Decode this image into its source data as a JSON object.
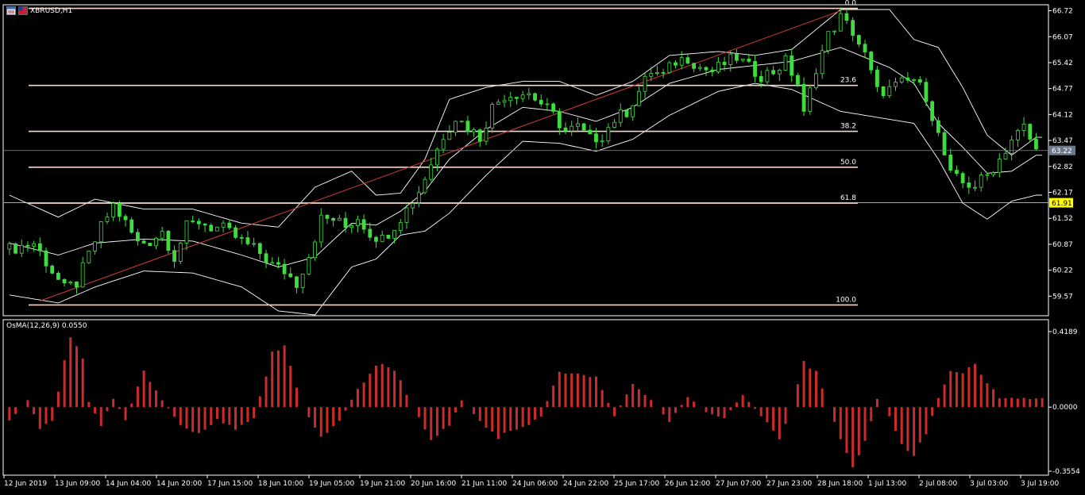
{
  "window": {
    "symbol_title": "XBRUSD,H1"
  },
  "indicator": {
    "label": "OsMA(12,26,9) 0.0550"
  },
  "colors": {
    "bg": "#000000",
    "frame": "#ffffff",
    "candle": "#3fdc3f",
    "fib": "#f7d6c8",
    "trend": "#d23b3b",
    "bands": "#ffffff",
    "osma": "#cc2b2b",
    "price_tag_bg": "#6b7b8c",
    "fib_tag_bg": "#ffff00"
  },
  "icons": {
    "window_icon": "chart-window-icon",
    "flag_icon": "symbol-flag-icon"
  },
  "chart_data": [
    {
      "type": "candlestick",
      "title": "XBRUSD,H1",
      "y_ticks": [
        "66.72",
        "66.07",
        "65.42",
        "64.77",
        "64.12",
        "63.47",
        "62.82",
        "62.17",
        "61.52",
        "60.87",
        "60.22",
        "59.57"
      ],
      "ylim": [
        59.1,
        66.85
      ],
      "x_ticks": [
        "12 Jun 2019",
        "13 Jun 09:00",
        "14 Jun 04:00",
        "14 Jun 20:00",
        "17 Jun 15:00",
        "18 Jun 10:00",
        "19 Jun 05:00",
        "19 Jun 21:00",
        "20 Jun 16:00",
        "21 Jun 11:00",
        "24 Jun 06:00",
        "24 Jun 22:00",
        "25 Jun 17:00",
        "26 Jun 12:00",
        "27 Jun 07:00",
        "27 Jun 23:00",
        "28 Jun 18:00",
        "1 Jul 13:00",
        "2 Jul 08:00",
        "3 Jul 03:00",
        "3 Jul 19:00"
      ],
      "close_path": [
        [
          0,
          60.75
        ],
        [
          4,
          60.9
        ],
        [
          7,
          60.2
        ],
        [
          9,
          59.75
        ],
        [
          11,
          59.9
        ],
        [
          13,
          60.6
        ],
        [
          15,
          61.3
        ],
        [
          17,
          61.85
        ],
        [
          19,
          61.4
        ],
        [
          21,
          60.9
        ],
        [
          23,
          60.95
        ],
        [
          25,
          61.2
        ],
        [
          27,
          60.55
        ],
        [
          29,
          61.3
        ],
        [
          31,
          61.45
        ],
        [
          33,
          61.3
        ],
        [
          35,
          61.25
        ],
        [
          37,
          61.05
        ],
        [
          39,
          60.85
        ],
        [
          41,
          60.65
        ],
        [
          43,
          60.35
        ],
        [
          45,
          60.2
        ],
        [
          47,
          59.9
        ],
        [
          49,
          60.6
        ],
        [
          51,
          61.5
        ],
        [
          53,
          61.5
        ],
        [
          55,
          61.3
        ],
        [
          57,
          61.55
        ],
        [
          59,
          61.15
        ],
        [
          61,
          61.0
        ],
        [
          63,
          61.35
        ],
        [
          65,
          61.75
        ],
        [
          67,
          62.2
        ],
        [
          69,
          62.9
        ],
        [
          71,
          63.6
        ],
        [
          73,
          64.05
        ],
        [
          75,
          63.8
        ],
        [
          77,
          63.55
        ],
        [
          79,
          64.3
        ],
        [
          81,
          64.6
        ],
        [
          83,
          64.65
        ],
        [
          85,
          64.65
        ],
        [
          87,
          64.4
        ],
        [
          89,
          64.1
        ],
        [
          91,
          63.7
        ],
        [
          93,
          63.8
        ],
        [
          95,
          63.5
        ],
        [
          97,
          63.6
        ],
        [
          99,
          64.0
        ],
        [
          101,
          64.2
        ],
        [
          103,
          64.7
        ],
        [
          105,
          65.2
        ],
        [
          107,
          65.1
        ],
        [
          109,
          65.45
        ],
        [
          111,
          65.55
        ],
        [
          113,
          65.3
        ],
        [
          115,
          65.2
        ],
        [
          117,
          65.4
        ],
        [
          119,
          65.55
        ],
        [
          121,
          65.3
        ],
        [
          123,
          65.1
        ],
        [
          125,
          65.2
        ],
        [
          127,
          65.45
        ],
        [
          129,
          64.9
        ],
        [
          130,
          64.1
        ],
        [
          132,
          65.3
        ],
        [
          134,
          66.1
        ],
        [
          136,
          66.55
        ],
        [
          138,
          66.2
        ],
        [
          140,
          65.6
        ],
        [
          142,
          64.7
        ],
        [
          144,
          64.75
        ],
        [
          146,
          64.9
        ],
        [
          148,
          65.0
        ],
        [
          150,
          64.6
        ],
        [
          152,
          63.6
        ],
        [
          154,
          62.6
        ],
        [
          156,
          62.4
        ],
        [
          158,
          62.35
        ],
        [
          160,
          62.6
        ],
        [
          162,
          63.0
        ],
        [
          164,
          63.5
        ],
        [
          166,
          63.8
        ],
        [
          168,
          63.2
        ]
      ],
      "bands_upper": [
        [
          0,
          62.1
        ],
        [
          8,
          61.55
        ],
        [
          14,
          62.0
        ],
        [
          22,
          61.75
        ],
        [
          30,
          61.75
        ],
        [
          38,
          61.4
        ],
        [
          44,
          61.3
        ],
        [
          50,
          62.3
        ],
        [
          56,
          62.7
        ],
        [
          60,
          62.1
        ],
        [
          64,
          62.15
        ],
        [
          68,
          63.0
        ],
        [
          72,
          64.5
        ],
        [
          78,
          64.8
        ],
        [
          84,
          64.95
        ],
        [
          90,
          64.95
        ],
        [
          96,
          64.6
        ],
        [
          102,
          64.95
        ],
        [
          108,
          65.6
        ],
        [
          116,
          65.7
        ],
        [
          122,
          65.6
        ],
        [
          128,
          65.75
        ],
        [
          136,
          66.75
        ],
        [
          144,
          66.75
        ],
        [
          148,
          66.0
        ],
        [
          152,
          65.8
        ],
        [
          156,
          64.8
        ],
        [
          160,
          63.6
        ],
        [
          164,
          63.1
        ],
        [
          168,
          63.55
        ]
      ],
      "bands_middle": [
        [
          0,
          60.9
        ],
        [
          8,
          60.6
        ],
        [
          14,
          60.9
        ],
        [
          22,
          61.0
        ],
        [
          30,
          60.95
        ],
        [
          38,
          60.6
        ],
        [
          44,
          60.3
        ],
        [
          50,
          60.55
        ],
        [
          56,
          61.4
        ],
        [
          60,
          61.35
        ],
        [
          64,
          61.7
        ],
        [
          68,
          62.2
        ],
        [
          72,
          63.0
        ],
        [
          78,
          63.75
        ],
        [
          84,
          64.3
        ],
        [
          90,
          64.2
        ],
        [
          96,
          63.95
        ],
        [
          102,
          64.3
        ],
        [
          108,
          64.9
        ],
        [
          116,
          65.25
        ],
        [
          122,
          65.35
        ],
        [
          128,
          65.45
        ],
        [
          136,
          65.8
        ],
        [
          144,
          65.3
        ],
        [
          148,
          64.9
        ],
        [
          152,
          63.9
        ],
        [
          156,
          63.3
        ],
        [
          160,
          62.65
        ],
        [
          164,
          62.7
        ],
        [
          168,
          63.1
        ]
      ],
      "bands_lower": [
        [
          0,
          59.6
        ],
        [
          8,
          59.4
        ],
        [
          14,
          59.8
        ],
        [
          22,
          60.2
        ],
        [
          30,
          60.15
        ],
        [
          38,
          59.8
        ],
        [
          44,
          59.2
        ],
        [
          50,
          59.1
        ],
        [
          56,
          60.3
        ],
        [
          60,
          60.5
        ],
        [
          64,
          61.1
        ],
        [
          68,
          61.2
        ],
        [
          72,
          61.65
        ],
        [
          78,
          62.6
        ],
        [
          84,
          63.45
        ],
        [
          90,
          63.4
        ],
        [
          96,
          63.2
        ],
        [
          102,
          63.5
        ],
        [
          108,
          64.1
        ],
        [
          116,
          64.7
        ],
        [
          122,
          64.9
        ],
        [
          128,
          64.75
        ],
        [
          136,
          64.2
        ],
        [
          144,
          64.0
        ],
        [
          148,
          63.9
        ],
        [
          152,
          63.0
        ],
        [
          156,
          61.9
        ],
        [
          160,
          61.5
        ],
        [
          164,
          61.95
        ],
        [
          168,
          62.1
        ]
      ],
      "fibonacci": {
        "levels": [
          {
            "label": "0.0",
            "price": 66.78
          },
          {
            "label": "23.6",
            "price": 64.85
          },
          {
            "label": "38.2",
            "price": 63.7
          },
          {
            "label": "50.0",
            "price": 62.8
          },
          {
            "label": "61.8",
            "price": 61.9
          },
          {
            "label": "100.0",
            "price": 59.35
          }
        ]
      },
      "trendline": {
        "from": [
          5,
          59.45
        ],
        "to": [
          136,
          66.72
        ]
      },
      "current_price": {
        "label": "63.22",
        "price": 63.22
      },
      "marker_price": {
        "label": "61.91",
        "price": 61.91
      },
      "bars_total": 170
    },
    {
      "type": "bar",
      "title": "OsMA(12,26,9) 0.0550",
      "y_ticks": [
        "0.4189",
        "0.0000",
        "-0.3554"
      ],
      "ylim": [
        -0.3554,
        0.4189
      ],
      "values_path": [
        [
          0,
          -0.08
        ],
        [
          3,
          0.04
        ],
        [
          5,
          -0.12
        ],
        [
          7,
          -0.08
        ],
        [
          9,
          0.25
        ],
        [
          10,
          0.4
        ],
        [
          12,
          0.28
        ],
        [
          13,
          0.03
        ],
        [
          15,
          -0.1
        ],
        [
          17,
          0.05
        ],
        [
          19,
          -0.07
        ],
        [
          22,
          0.2
        ],
        [
          25,
          0.04
        ],
        [
          28,
          -0.1
        ],
        [
          31,
          -0.15
        ],
        [
          34,
          -0.07
        ],
        [
          37,
          -0.12
        ],
        [
          40,
          -0.06
        ],
        [
          43,
          0.3
        ],
        [
          45,
          0.35
        ],
        [
          48,
          0.0
        ],
        [
          51,
          -0.17
        ],
        [
          54,
          -0.08
        ],
        [
          57,
          0.1
        ],
        [
          60,
          0.24
        ],
        [
          63,
          0.22
        ],
        [
          66,
          0.0
        ],
        [
          69,
          -0.18
        ],
        [
          72,
          -0.1
        ],
        [
          74,
          0.04
        ],
        [
          77,
          -0.08
        ],
        [
          80,
          -0.17
        ],
        [
          84,
          -0.12
        ],
        [
          87,
          -0.05
        ],
        [
          90,
          0.2
        ],
        [
          93,
          0.2
        ],
        [
          96,
          0.17
        ],
        [
          99,
          -0.05
        ],
        [
          102,
          0.13
        ],
        [
          105,
          0.04
        ],
        [
          108,
          -0.08
        ],
        [
          111,
          0.06
        ],
        [
          114,
          -0.03
        ],
        [
          117,
          -0.06
        ],
        [
          120,
          0.07
        ],
        [
          123,
          -0.05
        ],
        [
          126,
          -0.18
        ],
        [
          128,
          0.0
        ],
        [
          130,
          0.25
        ],
        [
          132,
          0.22
        ],
        [
          134,
          0.0
        ],
        [
          136,
          -0.18
        ],
        [
          138,
          -0.33
        ],
        [
          140,
          -0.2
        ],
        [
          142,
          0.05
        ],
        [
          144,
          -0.05
        ],
        [
          146,
          -0.2
        ],
        [
          148,
          -0.28
        ],
        [
          150,
          -0.15
        ],
        [
          152,
          0.05
        ],
        [
          154,
          0.2
        ],
        [
          156,
          0.2
        ],
        [
          158,
          0.25
        ],
        [
          160,
          0.14
        ],
        [
          162,
          0.05
        ]
      ],
      "bars_total": 170
    }
  ]
}
